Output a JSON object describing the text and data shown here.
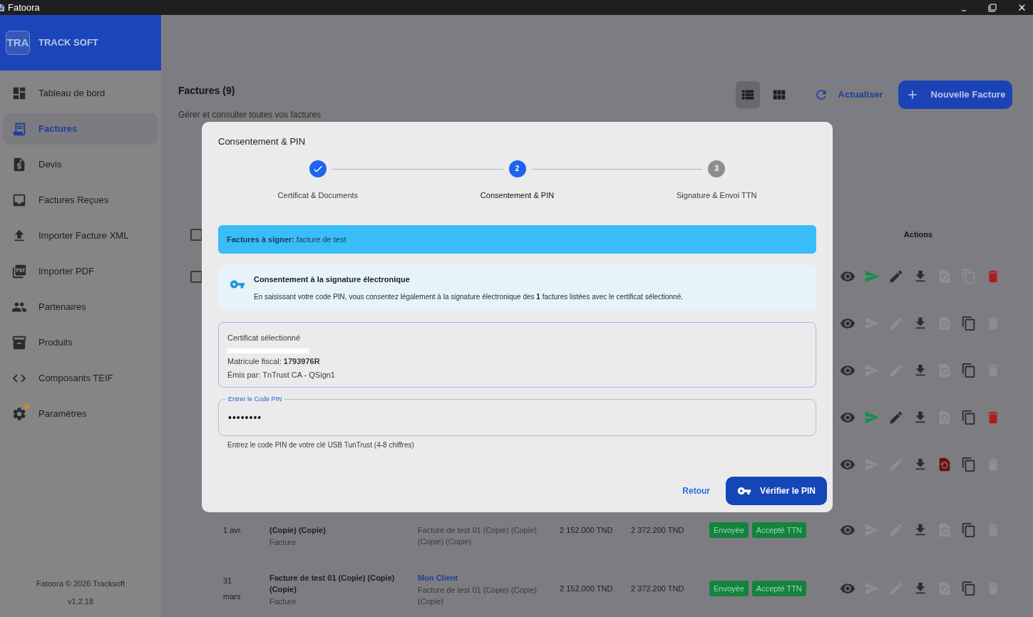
{
  "window": {
    "title": "Fatoora"
  },
  "sidebar": {
    "brand_badge": "TRA",
    "brand": "TRACK SOFT",
    "items": [
      {
        "label": "Tableau de bord",
        "selected": false
      },
      {
        "label": "Factures",
        "selected": true
      },
      {
        "label": "Devis",
        "selected": false
      },
      {
        "label": "Factures Reçues",
        "selected": false
      },
      {
        "label": "Importer Facture XML",
        "selected": false
      },
      {
        "label": "Importer PDF",
        "selected": false
      },
      {
        "label": "Partenaires",
        "selected": false
      },
      {
        "label": "Produits",
        "selected": false
      },
      {
        "label": "Composants TEIF",
        "selected": false
      },
      {
        "label": "Paramètres",
        "selected": false,
        "badge_dot": true
      }
    ],
    "footer": "Fatoora © 2026 Tracksoft",
    "version": "v1.2.18"
  },
  "page": {
    "title": "Factures (9)",
    "subtitle": "Gérer et consulter toutes vos factures",
    "view_toggle": [
      {
        "kind": "list",
        "selected": true
      },
      {
        "kind": "grid",
        "selected": false
      }
    ],
    "refresh_button": "Actualiser",
    "new_button": "Nouvelle Facture"
  },
  "table": {
    "header_checkbox": {
      "checked": false
    },
    "actions_header": "Actions",
    "rows": [
      {
        "kind": "covered",
        "checkbox": {
          "checked": false
        },
        "actions": {
          "send": true,
          "edit": true,
          "restore": false,
          "copy": false,
          "delete": true
        }
      },
      {
        "kind": "covered",
        "actions": {
          "send": false,
          "edit": false,
          "restore": false,
          "copy": true,
          "delete": false
        }
      },
      {
        "kind": "covered",
        "actions": {
          "send": false,
          "edit": false,
          "restore": false,
          "copy": true,
          "delete": false
        }
      },
      {
        "kind": "covered",
        "actions": {
          "send": true,
          "edit": true,
          "restore": false,
          "copy": true,
          "delete": true
        }
      },
      {
        "kind": "covered",
        "actions": {
          "send": false,
          "edit": false,
          "restore": true,
          "copy": true,
          "delete": false
        }
      },
      {
        "kind": "partly_covered",
        "date": [
          "1 avr."
        ],
        "title": "(Copie) (Copie)",
        "type": "Facture",
        "client_desc": "Facture de test 01 (Copie) (Copie) (Copie) (Copie)",
        "amount_ht": "2 152.000 TND",
        "amount_ttc": "2 372.200 TND",
        "statuses": [
          "Envoyée",
          "Accepté TTN"
        ],
        "actions": {
          "send": false,
          "edit": false,
          "restore": false,
          "copy": true,
          "delete": false
        }
      },
      {
        "kind": "full",
        "date": [
          "31",
          "mars"
        ],
        "title": "Facture de test 01 (Copie) (Copie) (Copie)",
        "type": "Facture",
        "client": "Mon Client",
        "client_desc": "Facture de test 01 (Copie) (Copie) (Copie)",
        "amount_ht": "2 152.000 TND",
        "amount_ttc": "2 372.200 TND",
        "statuses": [
          "Envoyée",
          "Accepté TTN"
        ],
        "actions": {
          "send": false,
          "edit": false,
          "restore": false,
          "copy": true,
          "delete": false
        }
      }
    ]
  },
  "dialog": {
    "title": "Consentement & PIN",
    "steps": [
      {
        "label": "Certificat & Documents",
        "done": true,
        "active": false
      },
      {
        "label": "Consentement & PIN",
        "number": "2",
        "done": false,
        "active": true
      },
      {
        "label": "Signature & Envoi TTN",
        "number": "3",
        "done": false,
        "active": false
      }
    ],
    "banner": "**Factures à signer:** facture de test",
    "consent": {
      "title": "Consentement à la signature électronique",
      "text": "En saisissant votre code PIN, vous consentez légalement à la signature électronique des **1** factures listées avec le certificat sélectionné."
    },
    "certificate": {
      "heading": "Certificat sélectionné",
      "lines": [
        "Matricule fiscal: **1793976R**",
        "Émis par: TnTrust CA - QSign1"
      ]
    },
    "pin": {
      "label": "Entrer le Code PIN",
      "value": "••••••••",
      "helper": "Entrez le code PIN de votre clé USB TunTrust (4-8 chiffres)"
    },
    "back_button": "Retour",
    "verify_button": "Vérifier le PIN"
  }
}
